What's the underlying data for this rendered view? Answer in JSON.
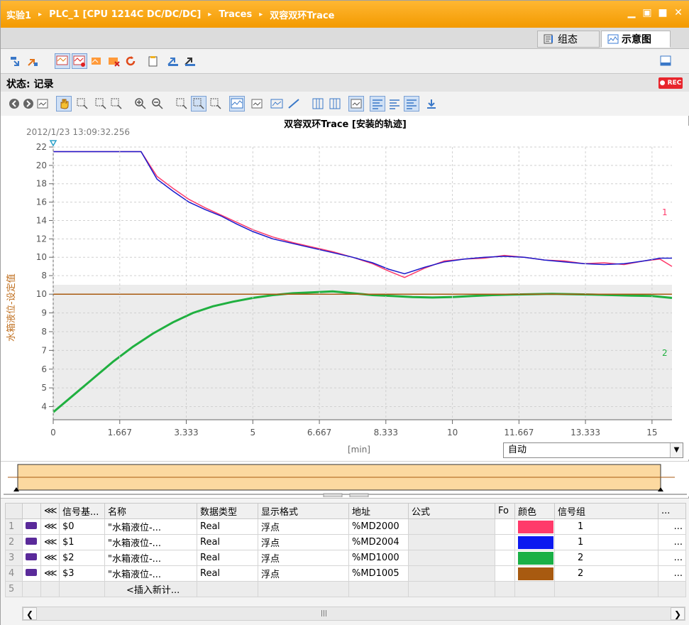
{
  "titlebar": {
    "crumbs": [
      "实验1",
      "PLC_1 [CPU 1214C DC/DC/DC]",
      "Traces",
      "双容双环Trace"
    ],
    "separator": "▸"
  },
  "view_tabs": [
    {
      "label": "组态",
      "active": false
    },
    {
      "label": "示意图",
      "active": true
    }
  ],
  "status": {
    "label": "状态: 记录",
    "rec_badge": "REC"
  },
  "chart_title": "双容双环Trace [安装的轨迹]",
  "timestamp": "2012/1/23 13:09:32.256",
  "x_axis": {
    "unit_label": "[min]",
    "tick_labels": [
      "0",
      "1.667",
      "3.333",
      "5",
      "6.667",
      "8.333",
      "10",
      "11.667",
      "13.333",
      "15"
    ]
  },
  "y_axis_label": "水箱液位-设定值",
  "scale_select": {
    "value": "自动"
  },
  "chart_data": [
    {
      "type": "line",
      "panel": "upper",
      "marker_label": "1",
      "ylim": [
        7,
        22
      ],
      "y_ticks": [
        "8",
        "10",
        "12",
        "14",
        "16",
        "18",
        "20",
        "22"
      ],
      "xlim": [
        0,
        15.5
      ],
      "series": [
        {
          "color": "#ff3a6a",
          "x": [
            0,
            1.0,
            2.2,
            2.6,
            3.0,
            3.4,
            3.8,
            4.2,
            4.6,
            5.0,
            5.5,
            6.0,
            6.5,
            7.0,
            7.5,
            8.0,
            8.4,
            8.8,
            9.3,
            9.8,
            10.3,
            10.8,
            11.3,
            11.8,
            12.3,
            12.8,
            13.3,
            13.8,
            14.3,
            14.8,
            15.2,
            15.5
          ],
          "y": [
            21.5,
            21.5,
            21.5,
            18.8,
            17.5,
            16.3,
            15.4,
            14.6,
            13.8,
            13.0,
            12.2,
            11.6,
            11.1,
            10.6,
            10.0,
            9.3,
            8.5,
            7.8,
            8.8,
            9.6,
            9.8,
            9.9,
            10.2,
            10.0,
            9.7,
            9.6,
            9.3,
            9.4,
            9.2,
            9.6,
            9.8,
            9.0
          ]
        },
        {
          "color": "#1a1acc",
          "x": [
            0,
            1.0,
            2.2,
            2.6,
            3.0,
            3.4,
            3.8,
            4.2,
            4.6,
            5.0,
            5.5,
            6.0,
            6.5,
            7.0,
            7.5,
            8.0,
            8.4,
            8.8,
            9.3,
            9.8,
            10.3,
            10.8,
            11.3,
            11.8,
            12.3,
            12.8,
            13.3,
            13.8,
            14.3,
            14.8,
            15.2,
            15.5
          ],
          "y": [
            21.5,
            21.5,
            21.5,
            18.5,
            17.2,
            16.0,
            15.2,
            14.5,
            13.6,
            12.8,
            12.0,
            11.5,
            11.0,
            10.5,
            10.0,
            9.4,
            8.7,
            8.2,
            8.9,
            9.5,
            9.8,
            10.0,
            10.1,
            10.0,
            9.7,
            9.5,
            9.3,
            9.2,
            9.3,
            9.6,
            9.9,
            9.9
          ]
        }
      ]
    },
    {
      "type": "line",
      "panel": "lower",
      "marker_label": "2",
      "ylim": [
        3.3,
        10.5
      ],
      "y_ticks": [
        "4",
        "5",
        "6",
        "7",
        "8",
        "9",
        "10"
      ],
      "xlim": [
        0,
        15.5
      ],
      "series": [
        {
          "color": "#20b040",
          "x": [
            0,
            0.5,
            1.0,
            1.5,
            2.0,
            2.5,
            3.0,
            3.5,
            4.0,
            4.5,
            5.0,
            5.5,
            6.0,
            6.5,
            7.0,
            7.5,
            8.0,
            8.5,
            9.0,
            9.5,
            10.0,
            10.5,
            11.0,
            11.5,
            12.0,
            12.5,
            13.0,
            13.5,
            14.0,
            14.5,
            15.0,
            15.5
          ],
          "y": [
            3.7,
            4.6,
            5.5,
            6.4,
            7.2,
            7.9,
            8.5,
            9.0,
            9.35,
            9.6,
            9.8,
            9.95,
            10.05,
            10.1,
            10.15,
            10.05,
            9.95,
            9.9,
            9.85,
            9.82,
            9.85,
            9.9,
            9.95,
            9.98,
            10.0,
            10.02,
            10.0,
            9.98,
            9.95,
            9.92,
            9.9,
            9.8
          ]
        },
        {
          "color": "#a85a10",
          "x": [
            0,
            15.5
          ],
          "y": [
            10.0,
            10.0
          ]
        }
      ]
    }
  ],
  "table": {
    "headers": [
      "",
      "",
      "信号基...",
      "名称",
      "数据类型",
      "显示格式",
      "地址",
      "公式",
      "",
      "颜色",
      "信号组",
      ""
    ],
    "rows": [
      {
        "num": "1",
        "sym": "$0",
        "name": "\"水箱液位-...",
        "dtype": "Real",
        "fmt": "浮点",
        "addr": "%MD2000",
        "color": "#ff3a6a",
        "group": "1",
        "more": "..."
      },
      {
        "num": "2",
        "sym": "$1",
        "name": "\"水箱液位-...",
        "dtype": "Real",
        "fmt": "浮点",
        "addr": "%MD2004",
        "color": "#0b19f0",
        "group": "1",
        "more": "..."
      },
      {
        "num": "3",
        "sym": "$2",
        "name": "\"水箱液位-...",
        "dtype": "Real",
        "fmt": "浮点",
        "addr": "%MD1000",
        "color": "#1ab046",
        "group": "2",
        "more": "..."
      },
      {
        "num": "4",
        "sym": "$3",
        "name": "\"水箱液位-...",
        "dtype": "Real",
        "fmt": "浮点",
        "addr": "%MD1005",
        "color": "#a85a10",
        "group": "2",
        "more": "..."
      }
    ],
    "new_row": {
      "num": "5",
      "label": "<插入新计..."
    }
  }
}
